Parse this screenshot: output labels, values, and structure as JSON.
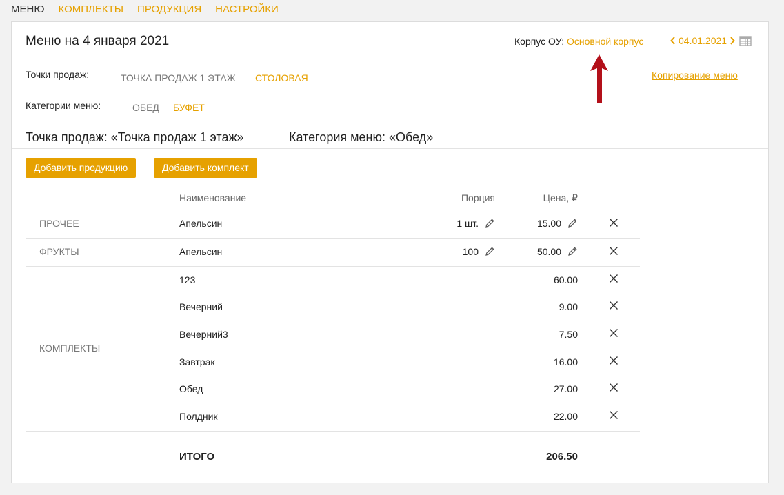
{
  "topnav": [
    {
      "label": "МЕНЮ"
    },
    {
      "label": "КОМПЛЕКТЫ"
    },
    {
      "label": "ПРОДУКЦИЯ"
    },
    {
      "label": "НАСТРОЙКИ"
    }
  ],
  "header": {
    "title": "Меню на 4 января 2021",
    "korpus_label": "Корпус ОУ:",
    "korpus_value": "Основной корпус",
    "date": "04.01.2021"
  },
  "filters": {
    "points_label": "Точки продаж:",
    "points": [
      {
        "label": "ТОЧКА ПРОДАЖ 1 ЭТАЖ"
      },
      {
        "label": "СТОЛОВАЯ"
      }
    ],
    "categories_label": "Категории меню:",
    "categories": [
      {
        "label": "ОБЕД"
      },
      {
        "label": "БУФЕТ"
      }
    ]
  },
  "copy_menu": "Копирование меню",
  "subtitle": {
    "point": "Точка продаж: «Точка продаж 1 этаж»",
    "category": "Категория меню: «Обед»"
  },
  "buttons": {
    "add_product": "Добавить продукцию",
    "add_set": "Добавить комплект"
  },
  "table": {
    "headers": {
      "name": "Наименование",
      "portion": "Порция",
      "price": "Цена, ₽"
    },
    "rows": [
      {
        "category": "ПРОЧЕЕ",
        "name": "Апельсин",
        "portion": "1 шт.",
        "price": "15.00"
      },
      {
        "category": "ФРУКТЫ",
        "name": "Апельсин",
        "portion": "100",
        "price": "50.00"
      }
    ],
    "sets_category": "КОМПЛЕКТЫ",
    "sets": [
      {
        "name": "123",
        "price": "60.00"
      },
      {
        "name": "Вечерний",
        "price": "9.00"
      },
      {
        "name": "Вечерний3",
        "price": "7.50"
      },
      {
        "name": "Завтрак",
        "price": "16.00"
      },
      {
        "name": "Обед",
        "price": "27.00"
      },
      {
        "name": "Полдник",
        "price": "22.00"
      }
    ],
    "total_label": "ИТОГО",
    "total_value": "206.50"
  },
  "colors": {
    "accent": "#e6a100",
    "arrow": "#b3101a"
  }
}
